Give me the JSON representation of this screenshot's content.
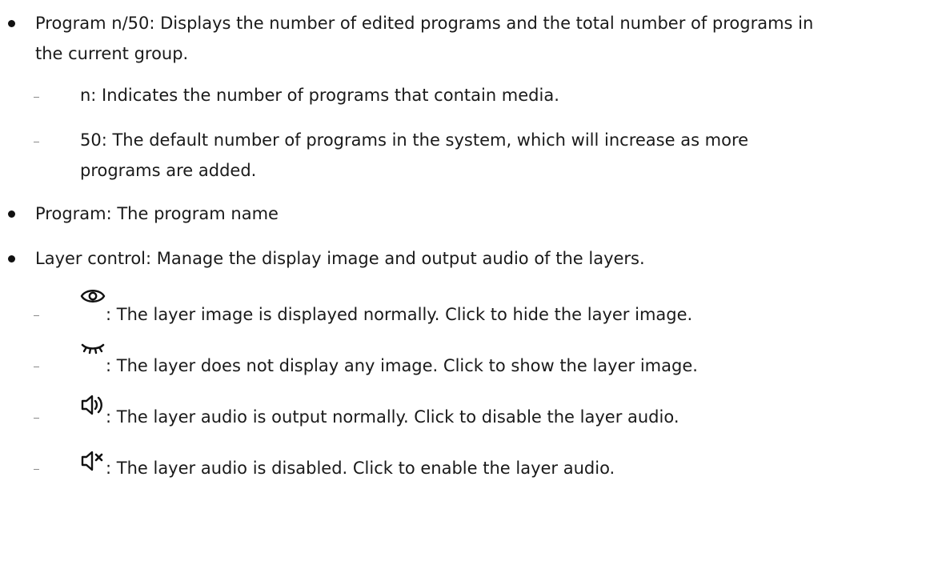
{
  "items": [
    {
      "line1": "Program n/50: Displays the number of edited programs and the total number of programs in",
      "line2": "the current group.",
      "subs": [
        {
          "text": "n: Indicates the number of programs that contain media."
        },
        {
          "line1": "50: The default number of programs in the system, which will increase as more",
          "line2": "programs are added."
        }
      ]
    },
    {
      "text": "Program: The program name"
    },
    {
      "text": "Layer control: Manage the display image and output audio of the layers.",
      "icons": [
        {
          "icon": "eye-open-icon",
          "text": ": The layer image is displayed normally. Click to hide the layer image."
        },
        {
          "icon": "eye-closed-icon",
          "text": ": The layer does not display any image. Click to show the layer image."
        },
        {
          "icon": "speaker-on-icon",
          "text": ": The layer audio is output normally. Click to disable the layer audio."
        },
        {
          "icon": "speaker-muted-icon",
          "text": ": The layer audio is disabled. Click to enable the layer audio."
        }
      ]
    }
  ]
}
